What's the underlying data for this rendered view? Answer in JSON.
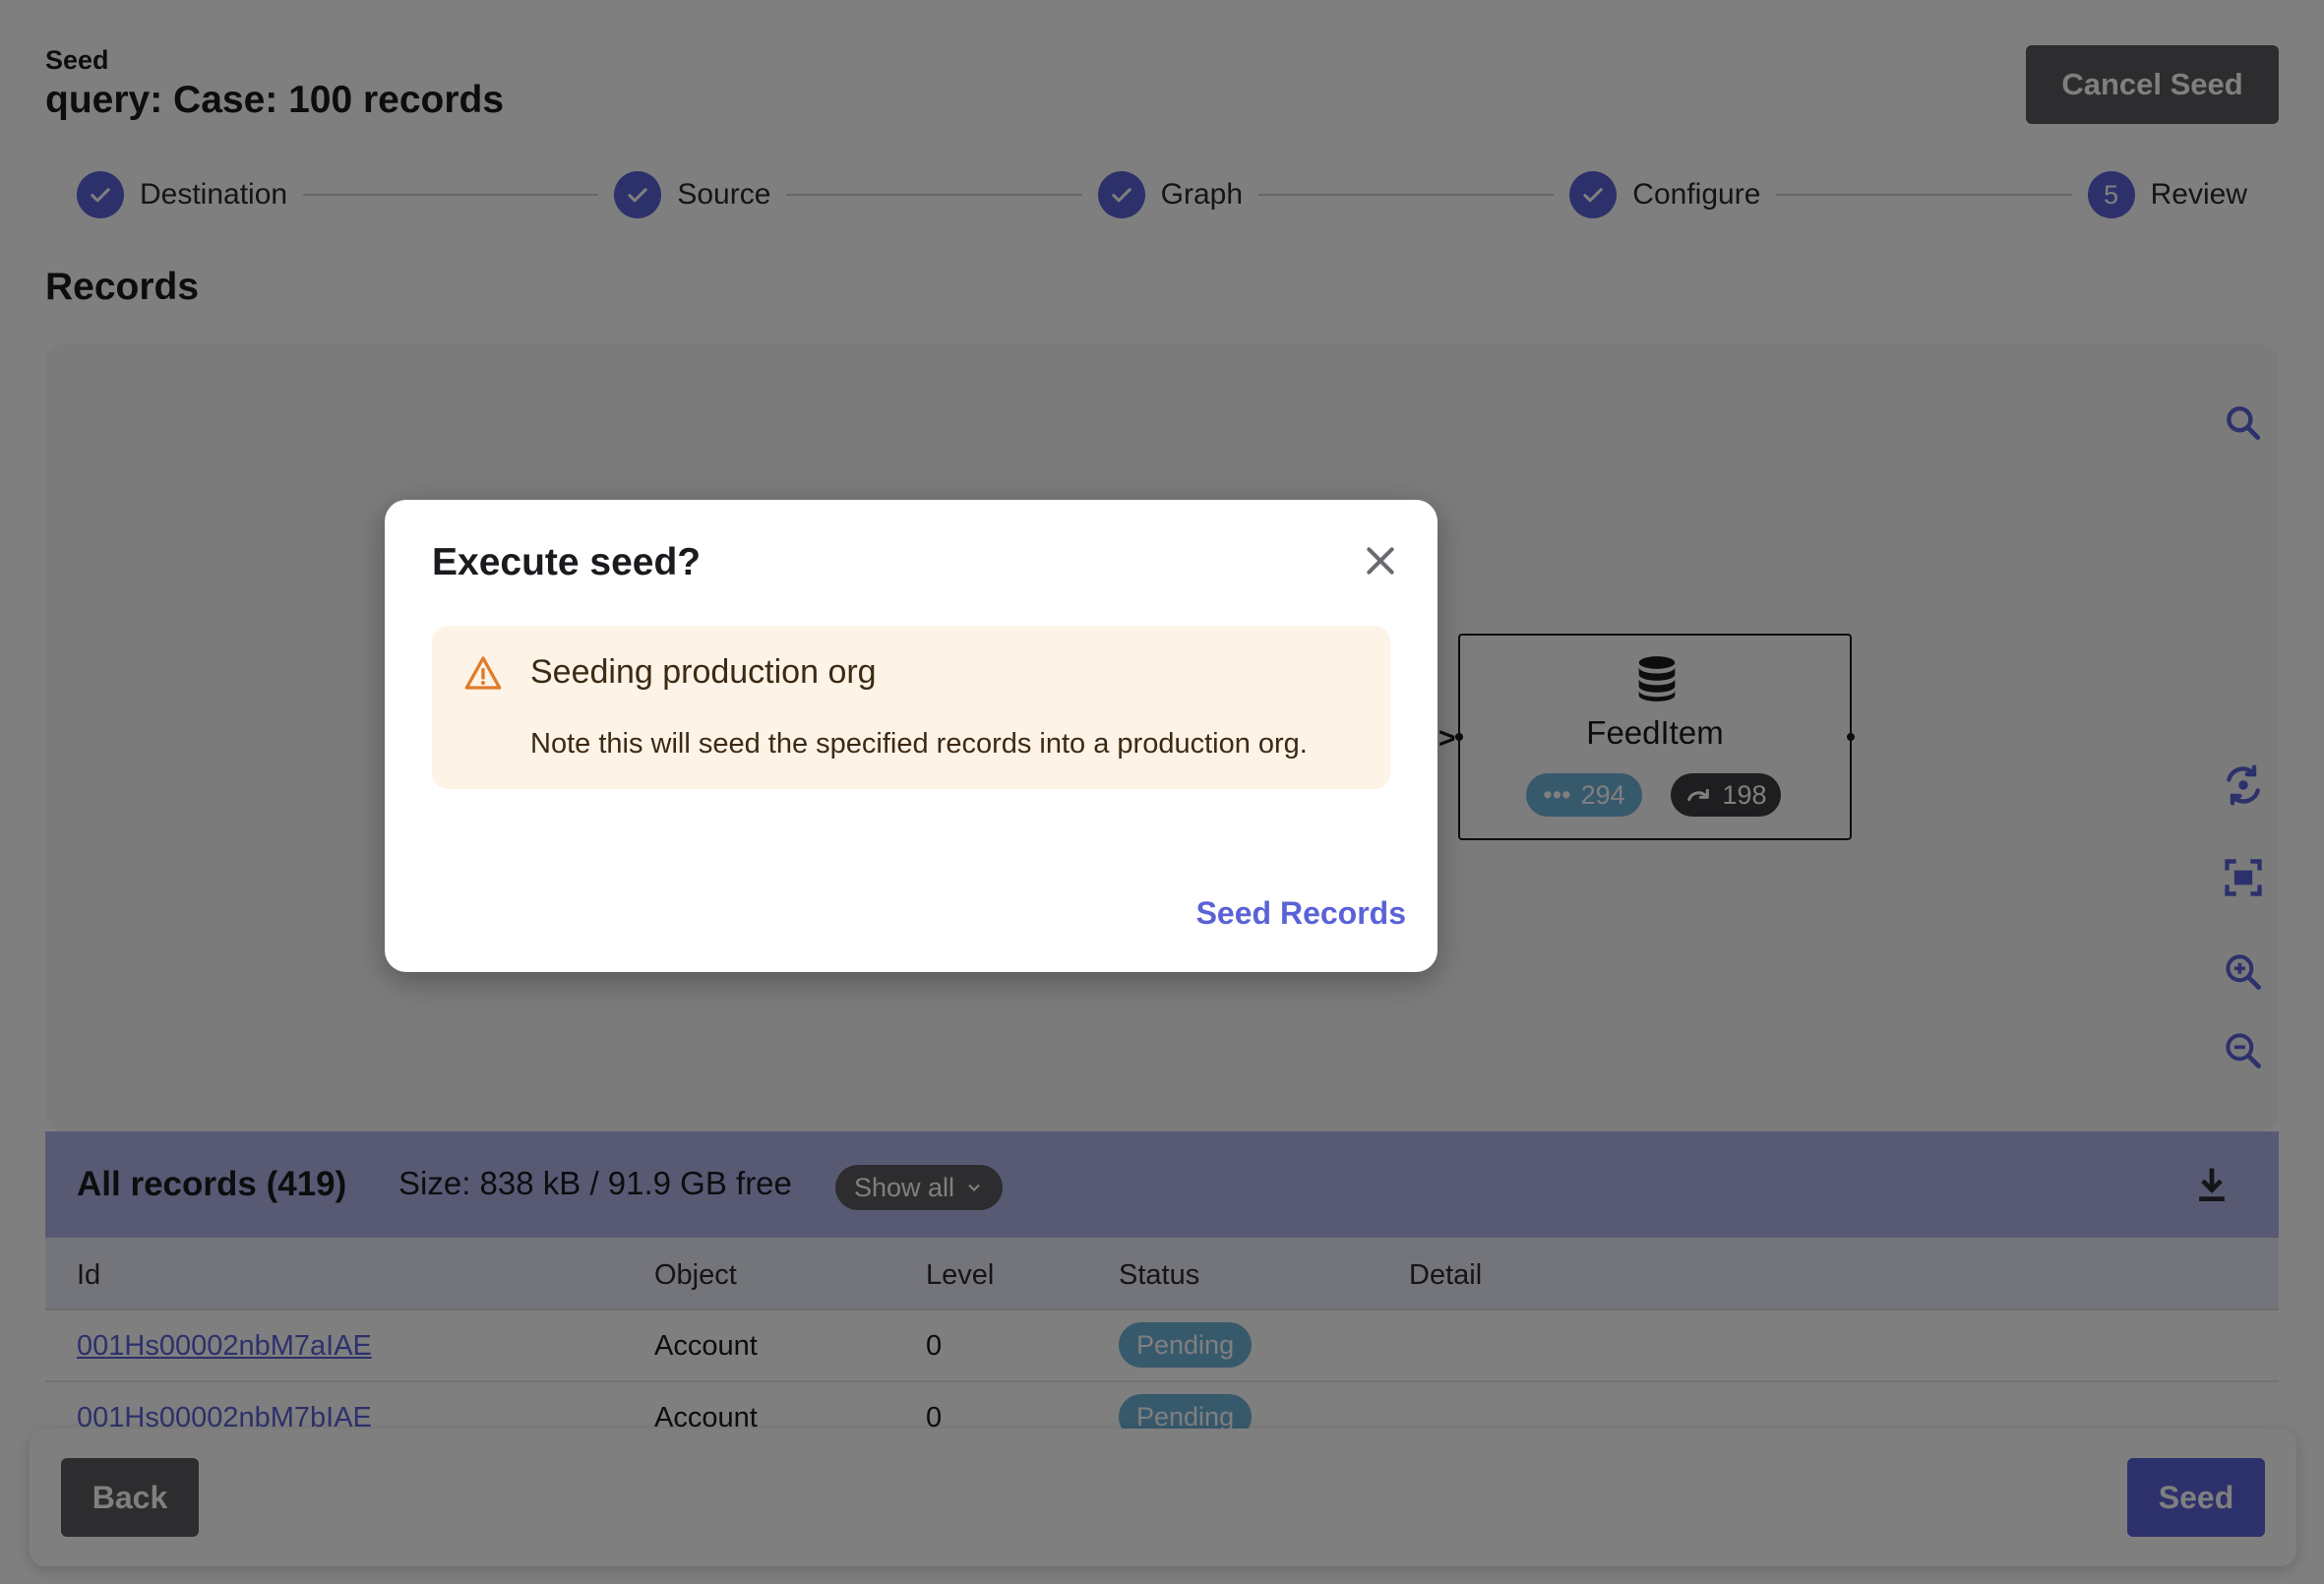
{
  "header": {
    "kicker": "Seed",
    "title": "query: Case: 100 records",
    "cancel_label": "Cancel Seed"
  },
  "stepper": {
    "steps": [
      {
        "label": "Destination",
        "state": "done"
      },
      {
        "label": "Source",
        "state": "done"
      },
      {
        "label": "Graph",
        "state": "done"
      },
      {
        "label": "Configure",
        "state": "done"
      },
      {
        "label": "Review",
        "state": "current",
        "number": "5"
      }
    ]
  },
  "records_section": {
    "title": "Records"
  },
  "graph": {
    "node": {
      "name": "FeedItem",
      "count_a": "294",
      "count_b": "198",
      "icon": "database-icon"
    },
    "tools": [
      "search-icon",
      "reload-icon",
      "fit-screen-icon",
      "zoom-in-icon",
      "zoom-out-icon"
    ]
  },
  "records_bar": {
    "title": "All records (419)",
    "size": "Size: 838 kB / 91.9 GB free",
    "filter": "Show all"
  },
  "table": {
    "headers": [
      "Id",
      "Object",
      "Level",
      "Status",
      "Detail"
    ],
    "rows": [
      {
        "id": "001Hs00002nbM7aIAE",
        "object": "Account",
        "level": "0",
        "status": "Pending",
        "detail": ""
      },
      {
        "id": "001Hs00002nbM7bIAE",
        "object": "Account",
        "level": "0",
        "status": "Pending",
        "detail": ""
      }
    ]
  },
  "footer": {
    "back_label": "Back",
    "seed_label": "Seed"
  },
  "modal": {
    "title": "Execute seed?",
    "alert_title": "Seeding production org",
    "alert_message": "Note this will seed the specified records into a production org.",
    "action_label": "Seed Records"
  },
  "colors": {
    "accent": "#5a62d6",
    "pending": "#6fb3d8",
    "warning": "#e07b2a",
    "alert_bg": "#fdf3e7"
  }
}
